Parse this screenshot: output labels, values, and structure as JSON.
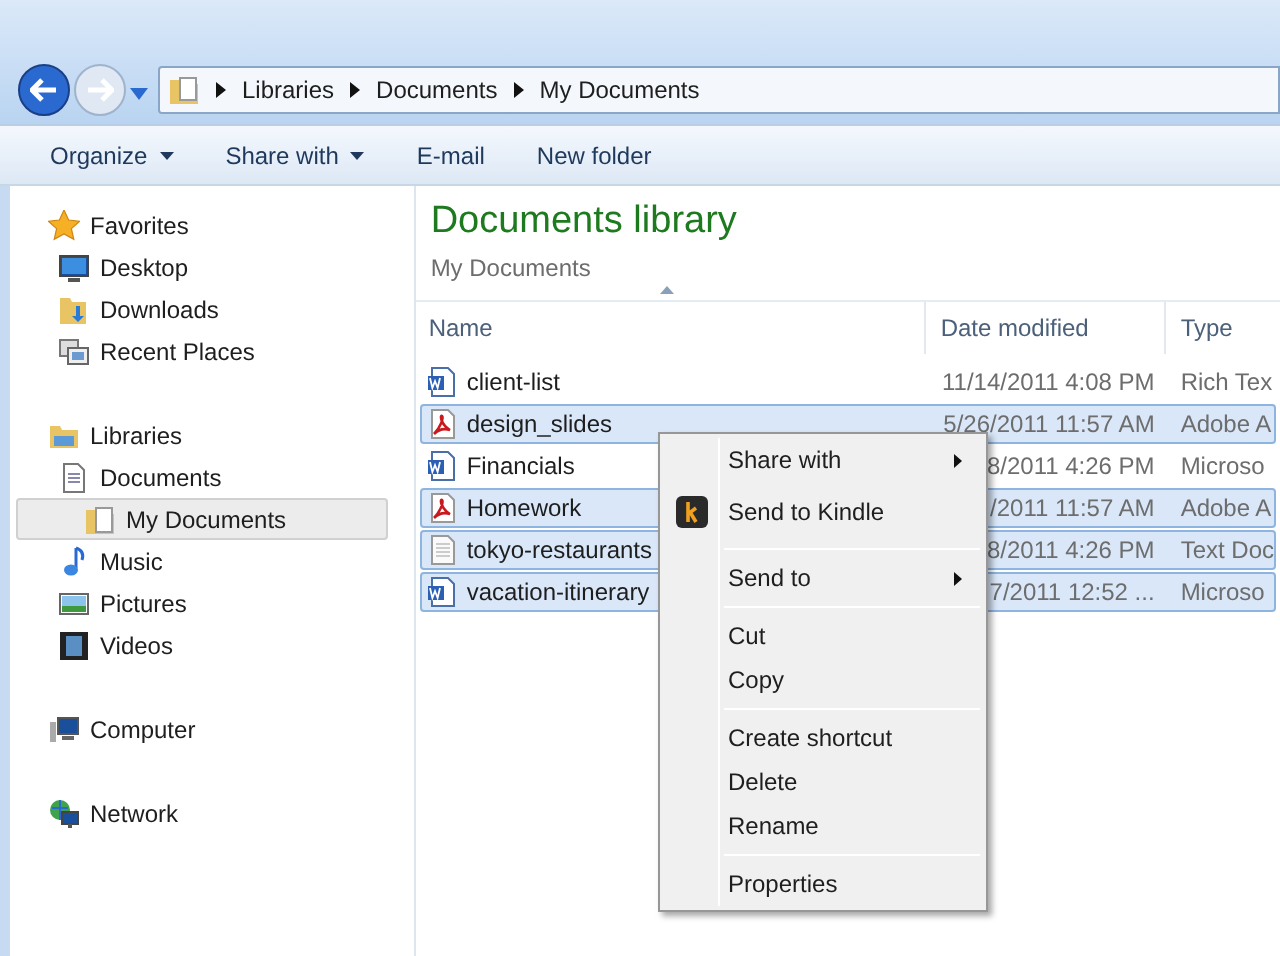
{
  "address_bar": {
    "crumbs": [
      "Libraries",
      "Documents",
      "My Documents"
    ]
  },
  "toolbar": [
    {
      "label": "Organize",
      "dropdown": true
    },
    {
      "label": "Share with",
      "dropdown": true
    },
    {
      "label": "E-mail",
      "dropdown": false
    },
    {
      "label": "New folder",
      "dropdown": false
    }
  ],
  "sidebar": {
    "groups": [
      {
        "label": "Favorites",
        "selected": false,
        "children": [
          {
            "label": "Desktop",
            "selected": false
          },
          {
            "label": "Downloads",
            "selected": false
          },
          {
            "label": "Recent Places",
            "selected": false
          }
        ]
      },
      {
        "label": "Libraries",
        "selected": false,
        "children": [
          {
            "label": "Documents",
            "selected": false,
            "children": [
              {
                "label": "My Documents",
                "selected": true
              }
            ]
          },
          {
            "label": "Music",
            "selected": false
          },
          {
            "label": "Pictures",
            "selected": false
          },
          {
            "label": "Videos",
            "selected": false
          }
        ]
      },
      {
        "label": "Computer",
        "selected": false
      },
      {
        "label": "Network",
        "selected": false
      }
    ]
  },
  "library": {
    "title": "Documents library",
    "subtitle": "My Documents"
  },
  "table": {
    "columns": [
      "Name",
      "Date modified",
      "Type"
    ],
    "rows": [
      {
        "kind": "word",
        "name": "client-list",
        "date": "11/14/2011 4:08 PM",
        "type": "Rich Tex",
        "selected": false
      },
      {
        "kind": "pdf",
        "name": "design_slides",
        "date": "5/26/2011 11:57 AM",
        "type": "Adobe A",
        "selected": true
      },
      {
        "kind": "word",
        "name": "Financials",
        "date": "8/2011 4:26 PM",
        "type": "Microso",
        "selected": false
      },
      {
        "kind": "pdf",
        "name": "Homework",
        "date": "/2011 11:57 AM",
        "type": "Adobe A",
        "selected": true
      },
      {
        "kind": "text",
        "name": "tokyo-restaurants",
        "date": "8/2011 4:26 PM",
        "type": "Text Doc",
        "selected": true
      },
      {
        "kind": "word",
        "name": "vacation-itinerary",
        "date": "7/2011 12:52 ...",
        "type": "Microso",
        "selected": true
      }
    ]
  },
  "context_menu": {
    "groups": [
      [
        {
          "label": "Share with",
          "submenu": true,
          "kind": "plain"
        },
        {
          "label": "Send to Kindle",
          "submenu": false,
          "kind": "kindle"
        }
      ],
      [
        {
          "label": "Send to",
          "submenu": true,
          "kind": "plain"
        }
      ],
      [
        {
          "label": "Cut",
          "submenu": false,
          "kind": "plain"
        },
        {
          "label": "Copy",
          "submenu": false,
          "kind": "plain"
        }
      ],
      [
        {
          "label": "Create shortcut",
          "submenu": false,
          "kind": "plain"
        },
        {
          "label": "Delete",
          "submenu": false,
          "kind": "plain"
        },
        {
          "label": "Rename",
          "submenu": false,
          "kind": "plain"
        }
      ],
      [
        {
          "label": "Properties",
          "submenu": false,
          "kind": "plain"
        }
      ]
    ]
  }
}
